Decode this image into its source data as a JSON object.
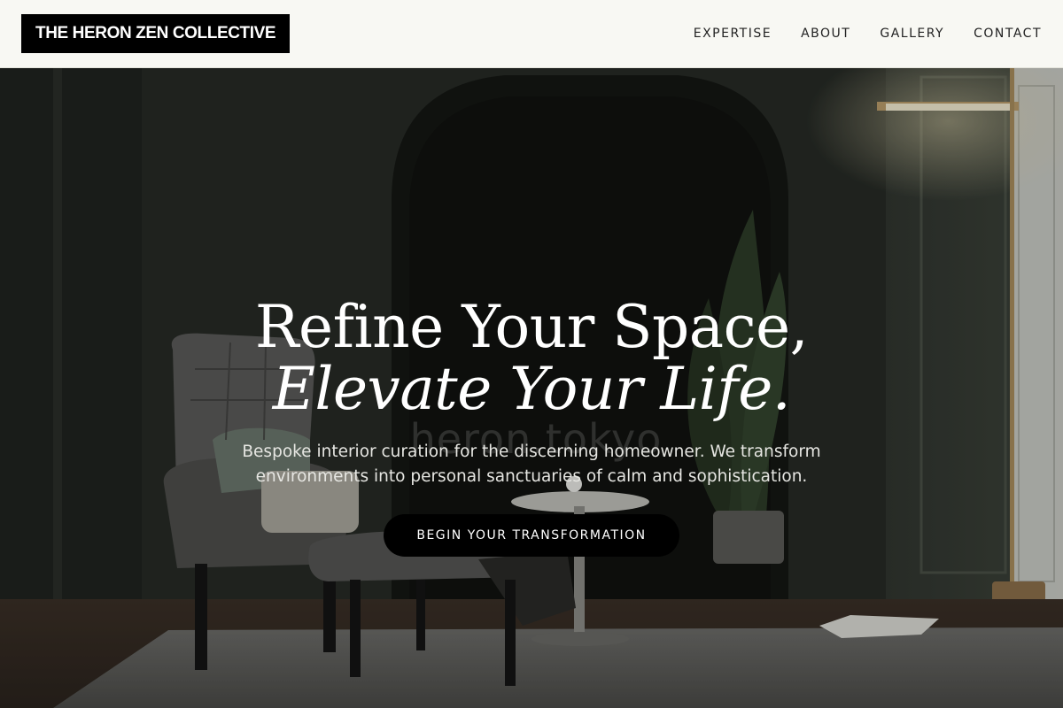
{
  "brand": {
    "name": "THE HERON ZEN COLLECTIVE"
  },
  "nav": {
    "items": [
      {
        "label": "EXPERTISE"
      },
      {
        "label": "ABOUT"
      },
      {
        "label": "GALLERY"
      },
      {
        "label": "CONTACT"
      }
    ]
  },
  "hero": {
    "headline_line1": "Refine Your Space,",
    "headline_line2": "Elevate Your Life.",
    "watermark": "heron.tokyo",
    "subtext": "Bespoke interior curation for the discerning homeowner. We transform environments into personal sanctuaries of calm and sophistication.",
    "cta_label": "BEGIN YOUR TRANSFORMATION"
  },
  "colors": {
    "header_bg": "#f8f8f3",
    "logo_bg": "#000000",
    "wall_dark": "#232722",
    "button_bg": "#000000"
  }
}
